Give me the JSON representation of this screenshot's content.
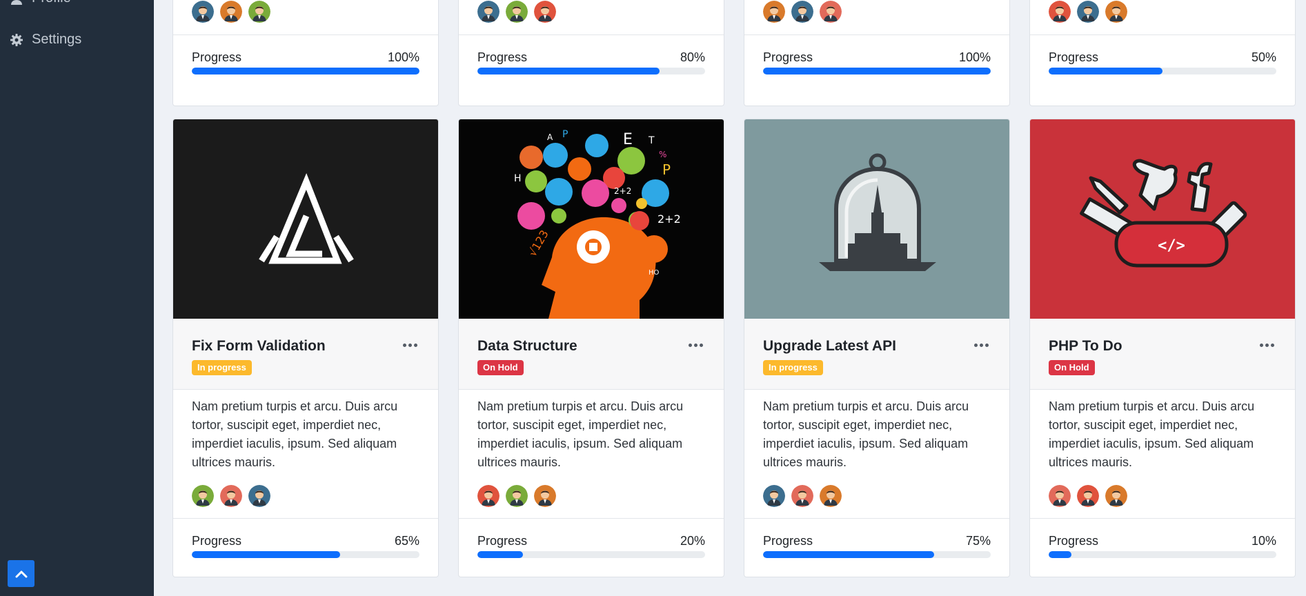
{
  "sidebar": {
    "profile_label": "Profile",
    "settings_label": "Settings",
    "settings_icon": "gear-icon",
    "scroll_top_icon": "chevron-up-icon"
  },
  "progress_label": "Progress",
  "colors": {
    "sidebar_bg": "#222e3c",
    "accent": "#0d6efd",
    "badge_in_progress": "#fcb92c",
    "badge_on_hold": "#dc3545"
  },
  "top_cards": [
    {
      "avatars": [
        "#3c6e8f",
        "#d97a2b",
        "#7aab3a"
      ],
      "progress_text": "100%",
      "progress": 100
    },
    {
      "avatars": [
        "#3c6e8f",
        "#7aab3a",
        "#e0533d"
      ],
      "progress_text": "80%",
      "progress": 80
    },
    {
      "avatars": [
        "#d97a2b",
        "#3c6e8f",
        "#e26a5a"
      ],
      "progress_text": "100%",
      "progress": 100
    },
    {
      "avatars": [
        "#e0533d",
        "#3c6e8f",
        "#d97a2b"
      ],
      "progress_text": "50%",
      "progress": 50
    }
  ],
  "cards": [
    {
      "title": "Fix Form Validation",
      "status": "In progress",
      "status_type": "progress",
      "image_name": "logo-image",
      "description": "Nam pretium turpis et arcu. Duis arcu tortor, suscipit eget, imperdiet nec, imperdiet iaculis, ipsum. Sed aliquam ultrices mauris.",
      "avatars": [
        "#7aab3a",
        "#e26a5a",
        "#3c6e8f"
      ],
      "progress_text": "65%",
      "progress": 65
    },
    {
      "title": "Data Structure",
      "status": "On Hold",
      "status_type": "hold",
      "image_name": "brain-illustration-image",
      "description": "Nam pretium turpis et arcu. Duis arcu tortor, suscipit eget, imperdiet nec, imperdiet iaculis, ipsum. Sed aliquam ultrices mauris.",
      "avatars": [
        "#e0533d",
        "#7aab3a",
        "#d97a2b"
      ],
      "progress_text": "20%",
      "progress": 20
    },
    {
      "title": "Upgrade Latest API",
      "status": "In progress",
      "status_type": "progress",
      "image_name": "bell-jar-church-image",
      "description": "Nam pretium turpis et arcu. Duis arcu tortor, suscipit eget, imperdiet nec, imperdiet iaculis, ipsum. Sed aliquam ultrices mauris.",
      "avatars": [
        "#3c6e8f",
        "#e26a5a",
        "#d97a2b"
      ],
      "progress_text": "75%",
      "progress": 75
    },
    {
      "title": "PHP To Do",
      "status": "On Hold",
      "status_type": "hold",
      "image_name": "swiss-knife-social-image",
      "description": "Nam pretium turpis et arcu. Duis arcu tortor, suscipit eget, imperdiet nec, imperdiet iaculis, ipsum. Sed aliquam ultrices mauris.",
      "avatars": [
        "#e26a5a",
        "#e0533d",
        "#d97a2b"
      ],
      "progress_text": "10%",
      "progress": 10
    }
  ]
}
